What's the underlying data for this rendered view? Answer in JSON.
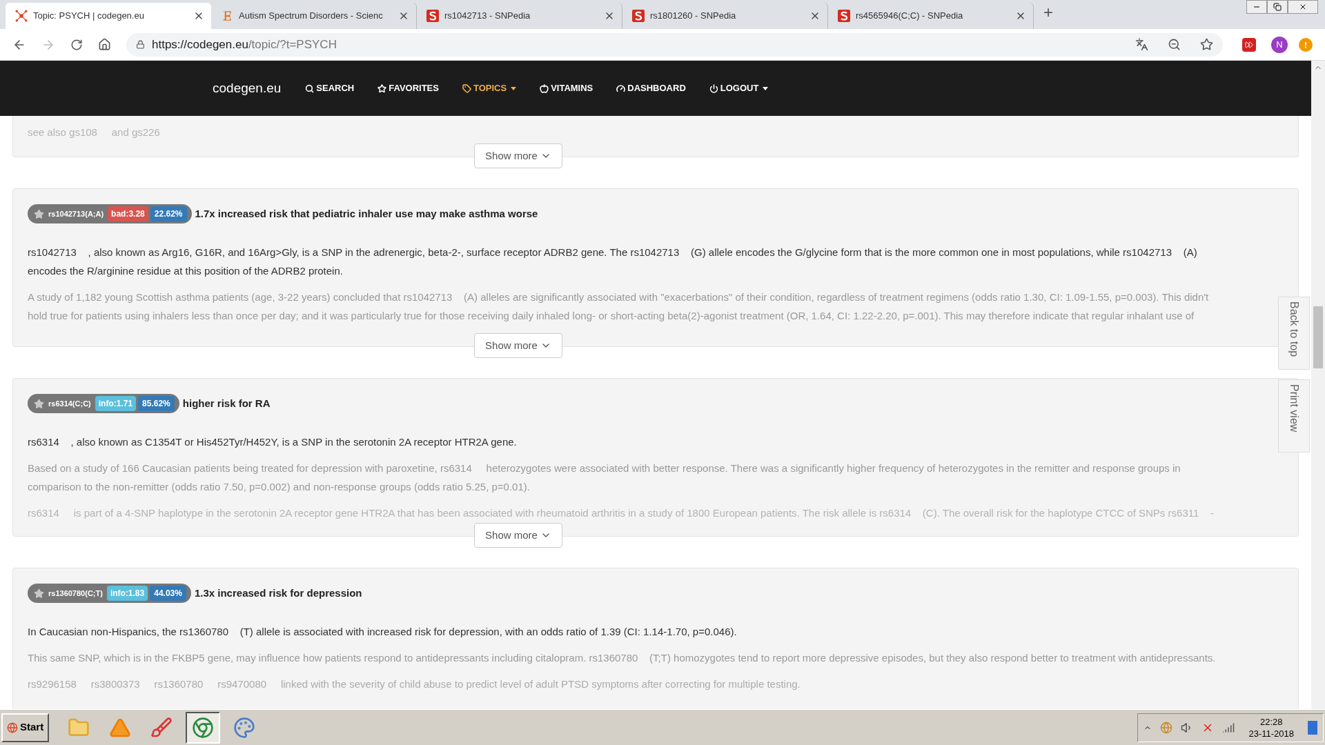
{
  "browser": {
    "tabs": [
      {
        "title": "Topic: PSYCH | codegen.eu",
        "selected": true
      },
      {
        "title": "Autism Spectrum Disorders - Scienc",
        "selected": false
      },
      {
        "title": "rs1042713 - SNPedia",
        "selected": false
      },
      {
        "title": "rs1801260 - SNPedia",
        "selected": false
      },
      {
        "title": "rs4565946(C;C) - SNPedia",
        "selected": false
      }
    ],
    "new_tab": "+",
    "address": {
      "host": "https://codegen.eu",
      "path": "/topic/?t=PSYCH"
    },
    "avatar": "N"
  },
  "navbar": {
    "brand": "codegen.eu",
    "items": [
      {
        "label": "SEARCH",
        "selected": false,
        "caret": false
      },
      {
        "label": "FAVORITES",
        "selected": false,
        "caret": false
      },
      {
        "label": "TOPICS",
        "selected": true,
        "caret": true
      },
      {
        "label": "VITAMINS",
        "selected": false,
        "caret": false
      },
      {
        "label": "DASHBOARD",
        "selected": false,
        "caret": false
      },
      {
        "label": "LOGOUT",
        "selected": false,
        "caret": true
      }
    ]
  },
  "cards": [
    {
      "kind": "partial",
      "paragraphs": [
        {
          "kind": "faint",
          "lines": [
            "see also gs108     and gs226"
          ]
        }
      ],
      "show_more": "Show more"
    },
    {
      "kind": "snp",
      "badge": {
        "rsid": "rs1042713(A;A)",
        "score": "bad:3.28",
        "kind": "bad",
        "percent": "22.62%"
      },
      "title": "1.7x increased risk that pediatric inhaler use may make asthma worse",
      "paragraphs": [
        {
          "kind": "normal",
          "lines": [
            "rs1042713    , also known as Arg16, G16R, and 16Arg>Gly, is a SNP in the adrenergic, beta-2-, surface receptor ADRB2 gene. The rs1042713    (G) allele encodes the G/glycine form that is the more common one in most populations, while rs1042713    (A)",
            "encodes the R/arginine residue at this position of the ADRB2 protein."
          ]
        },
        {
          "kind": "muted",
          "lines": [
            "A study of 1,182 young Scottish asthma patients (age, 3-22 years) concluded that rs1042713    (A) alleles are significantly associated with \"exacerbations\" of their condition, regardless of treatment regimens (odds ratio 1.30, CI: 1.09-1.55, p=0.003). This didn't",
            "hold true for patients using inhalers less than once per day; and it was particularly true for those receiving daily inhaled long- or short-acting beta(2)-agonist treatment (OR, 1.64, CI: 1.22-2.20, p=.001). This may therefore indicate that regular inhalant use of"
          ]
        }
      ],
      "show_more": "Show more"
    },
    {
      "kind": "snp",
      "badge": {
        "rsid": "rs6314(C;C)",
        "score": "info:1.71",
        "kind": "info",
        "percent": "85.62%"
      },
      "title": "higher risk for RA",
      "paragraphs": [
        {
          "kind": "normal",
          "lines": [
            "rs6314    , also known as C1354T or His452Tyr/H452Y, is a SNP in the serotonin 2A receptor HTR2A gene."
          ]
        },
        {
          "kind": "muted",
          "lines": [
            "Based on a study of 166 Caucasian patients being treated for depression with paroxetine, rs6314     heterozygotes were associated with better response. There was a significantly higher frequency of heterozygotes in the remitter and response groups in",
            "comparison to the non-remitter (odds ratio 7.50, p=0.002) and non-response groups (odds ratio 5.25, p=0.01)."
          ]
        },
        {
          "kind": "faint",
          "lines": [
            "rs6314     is part of a 4-SNP haplotype in the serotonin 2A receptor gene HTR2A that has been associated with rheumatoid arthritis in a study of 1800 European patients. The risk allele is rs6314    (C). The overall risk for the haplotype CTCC of SNPs rs6311    -"
          ]
        }
      ],
      "show_more": "Show more"
    },
    {
      "kind": "snp",
      "badge": {
        "rsid": "rs1360780(C;T)",
        "score": "info:1.83",
        "kind": "info",
        "percent": "44.03%"
      },
      "title": "1.3x increased risk for depression",
      "paragraphs": [
        {
          "kind": "normal",
          "lines": [
            "In Caucasian non-Hispanics, the rs1360780    (T) allele is associated with increased risk for depression, with an odds ratio of 1.39 (CI: 1.14-1.70, p=0.046)."
          ]
        },
        {
          "kind": "muted",
          "lines": [
            "This same SNP, which is in the FKBP5 gene, may influence how patients respond to antidepressants including citalopram. rs1360780    (T;T) homozygotes tend to report more depressive episodes, but they also respond better to treatment with antidepressants."
          ]
        },
        {
          "kind": "light",
          "lines": [
            "rs9296158     rs3800373     rs1360780     rs9470080     linked with the severity of child abuse to predict level of adult PTSD symptoms after correcting for multiple testing."
          ]
        }
      ]
    }
  ],
  "side_tabs": [
    "Back to top",
    "Print view"
  ],
  "taskbar": {
    "start": "Start",
    "apps": [
      {
        "selected": false
      },
      {
        "selected": false
      },
      {
        "selected": false
      },
      {
        "selected": true
      },
      {
        "selected": false
      }
    ],
    "time": "22:28",
    "date": "23-11-2018"
  }
}
